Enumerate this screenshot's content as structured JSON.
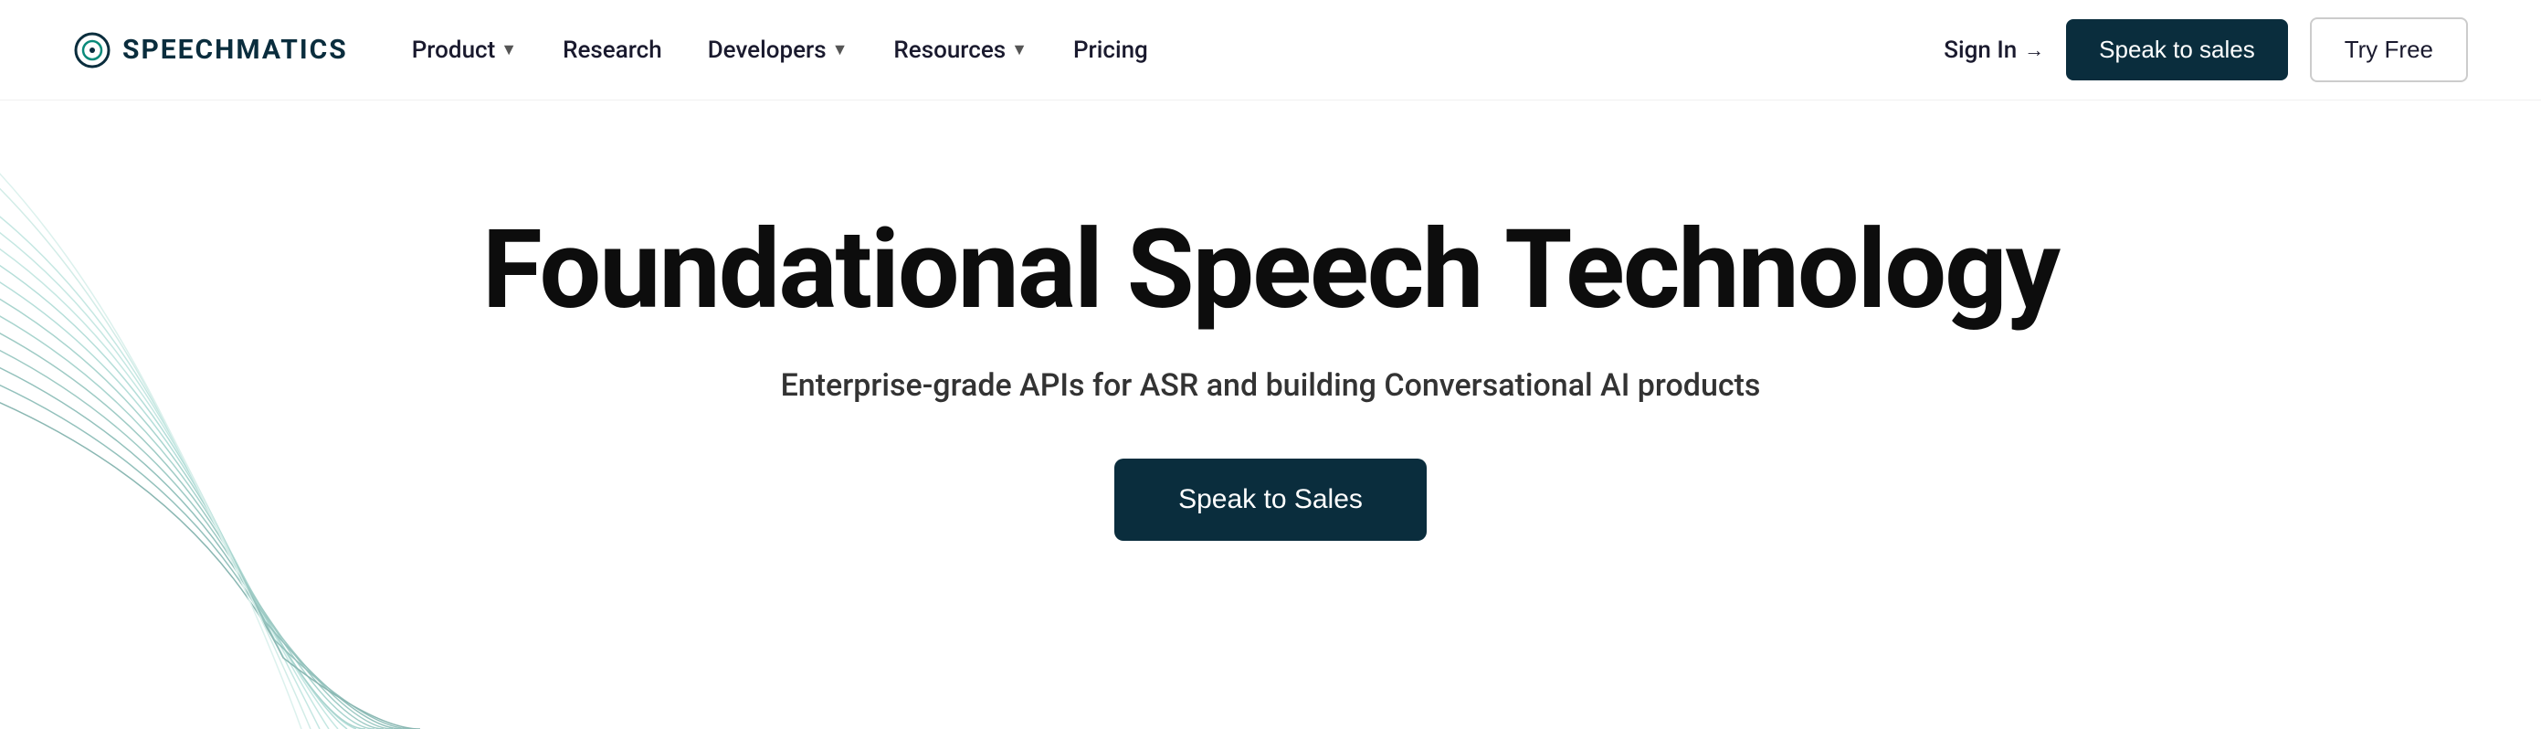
{
  "brand": {
    "name": "SPEECHMATICS",
    "logo_alt": "Speechmatics logo"
  },
  "nav": {
    "links": [
      {
        "label": "Product",
        "has_dropdown": true
      },
      {
        "label": "Research",
        "has_dropdown": false
      },
      {
        "label": "Developers",
        "has_dropdown": true
      },
      {
        "label": "Resources",
        "has_dropdown": true
      },
      {
        "label": "Pricing",
        "has_dropdown": false
      }
    ],
    "sign_in": "Sign In",
    "speak_to_sales": "Speak to sales",
    "try_free": "Try Free"
  },
  "hero": {
    "title": "Foundational Speech Technology",
    "subtitle": "Enterprise-grade APIs for ASR and building Conversational AI products",
    "cta_label": "Speak to Sales"
  },
  "colors": {
    "brand_dark": "#0a2d3d",
    "text_dark": "#0d0d0d",
    "text_mid": "#333333"
  }
}
